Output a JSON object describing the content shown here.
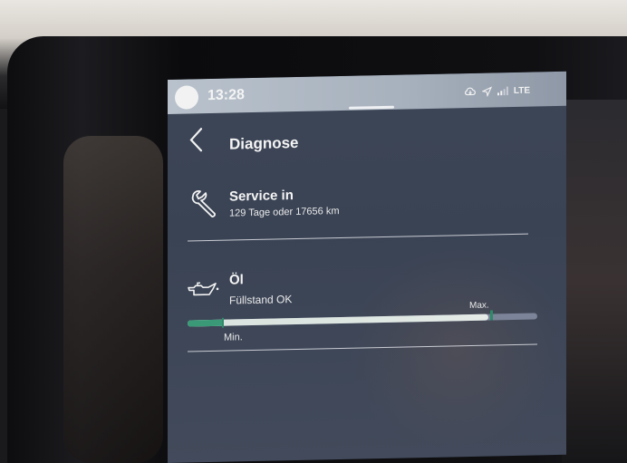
{
  "statusbar": {
    "time": "13:28",
    "network": "LTE"
  },
  "header": {
    "title": "Diagnose",
    "back_icon": "chevron-left-icon"
  },
  "service": {
    "icon": "wrench-icon",
    "title": "Service in",
    "detail": "129 Tage oder 17656 km"
  },
  "oil": {
    "icon": "oil-can-icon",
    "title": "Öl",
    "status": "Füllstand OK",
    "level_fraction": 0.86,
    "min_label": "Min.",
    "max_label": "Max."
  },
  "colors": {
    "accent_green": "#3a9a77",
    "screen_bg": "#3d4657"
  }
}
